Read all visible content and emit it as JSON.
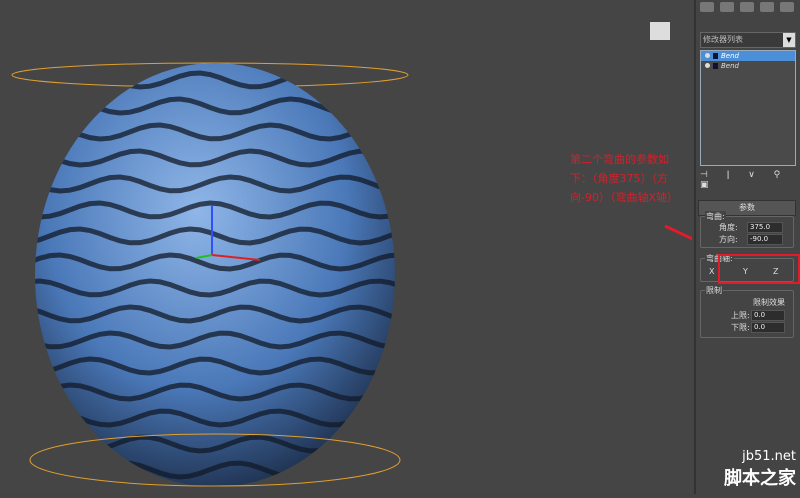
{
  "viewport": {
    "object": "bend-sphere"
  },
  "panel": {
    "modifier_list": "修改器列表",
    "stack": [
      {
        "label": "Bend",
        "selected": true
      },
      {
        "label": "Bend",
        "selected": false
      }
    ],
    "rollout_title": "参数",
    "bend_group": "弯曲:",
    "angle_label": "角度:",
    "angle_value": "375.0",
    "direction_label": "方向:",
    "direction_value": "-90.0",
    "axis_group": "弯曲轴:",
    "axes": [
      "X",
      "Y",
      "Z"
    ],
    "axis_selected": "X",
    "limits_group": "限制",
    "limit_effect": "限制效果",
    "upper_label": "上限:",
    "upper_value": "0.0",
    "lower_label": "下限:",
    "lower_value": "0.0"
  },
  "annotation": "第二个弯曲的参数如下：（角度375）（方向-90）（弯曲轴X轴）",
  "watermark": {
    "site": "jb51.net",
    "name": "脚本之家"
  },
  "colors": {
    "accent": "#e21b2a",
    "sphere": "#4a78b8"
  }
}
